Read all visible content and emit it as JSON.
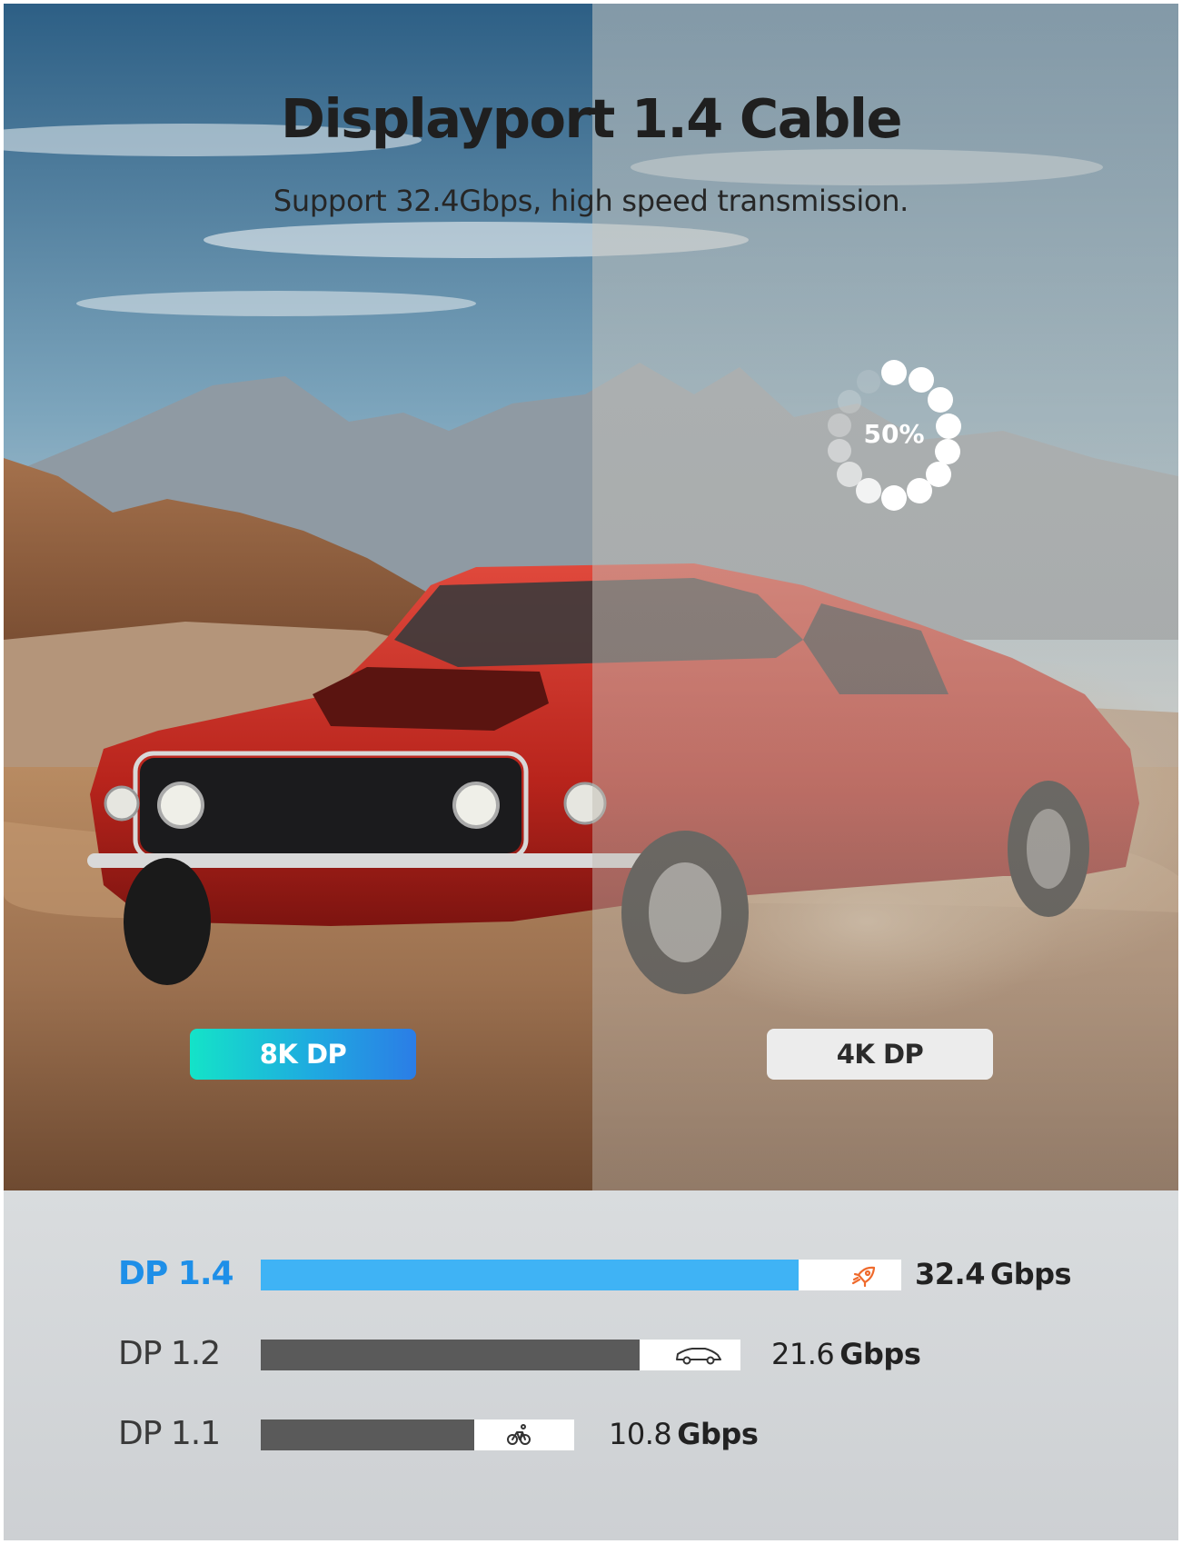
{
  "hero": {
    "title": "Displayport 1.4 Cable",
    "subtitle": "Support 32.4Gbps, high speed transmission.",
    "loading_percent_label": "50%",
    "left_badge": "8K DP",
    "right_badge": "4K DP"
  },
  "comparison": {
    "max_gbps": 32.4,
    "rows": [
      {
        "label": "DP 1.4",
        "value": "32.4",
        "unit": "Gbps",
        "gbps": 32.4,
        "fill_fraction": 0.84,
        "icon": "rocket-icon",
        "highlight": true,
        "fill_color": "#3fb3f5",
        "icon_color": "#ef6a2c"
      },
      {
        "label": "DP 1.2",
        "value": "21.6",
        "unit": "Gbps",
        "gbps": 21.6,
        "fill_fraction": 0.79,
        "icon": "car-icon",
        "highlight": false,
        "fill_color": "#5a5a5a",
        "icon_color": "#333333"
      },
      {
        "label": "DP 1.1",
        "value": "10.8",
        "unit": "Gbps",
        "gbps": 10.8,
        "fill_fraction": 0.68,
        "icon": "bicycle-icon",
        "highlight": false,
        "fill_color": "#5a5a5a",
        "icon_color": "#333333"
      }
    ]
  }
}
